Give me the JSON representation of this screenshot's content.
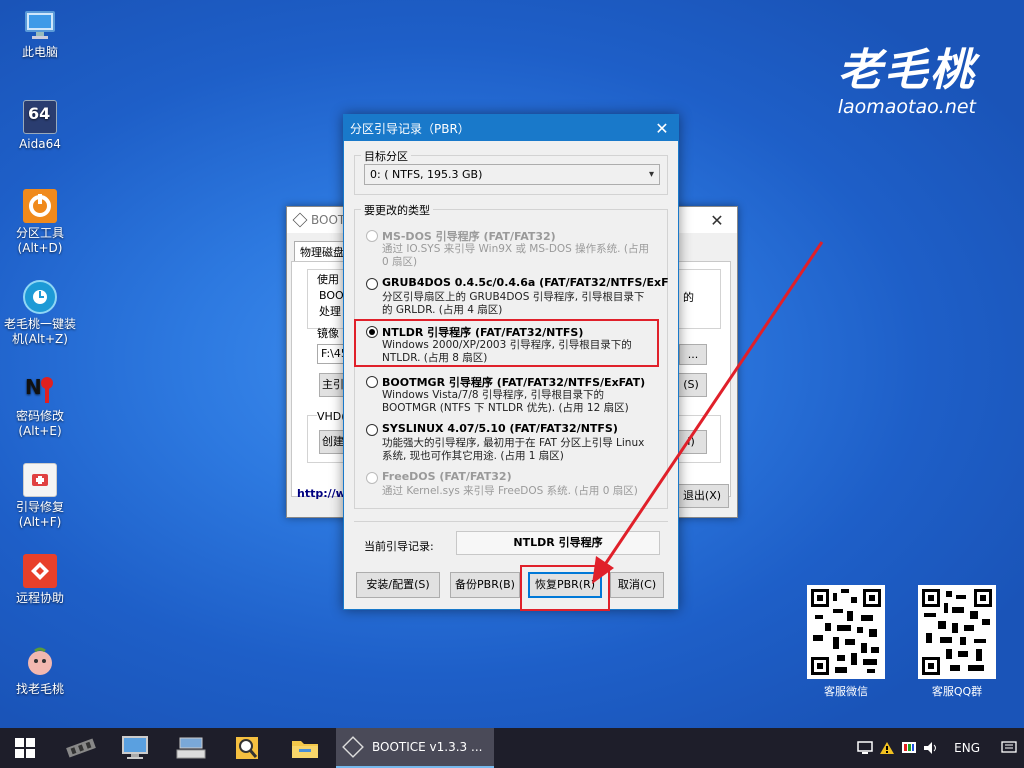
{
  "desktop": {
    "icons": [
      {
        "label": "此电脑",
        "icon": "computer-icon"
      },
      {
        "label": "Aida64",
        "icon": "aida64-icon"
      },
      {
        "label": "分区工具\n(Alt+D)",
        "icon": "partition-tool-icon"
      },
      {
        "label": "老毛桃一键装\n机(Alt+Z)",
        "icon": "one-click-install-icon"
      },
      {
        "label": "密码修改\n(Alt+E)",
        "icon": "password-change-icon"
      },
      {
        "label": "引导修复\n(Alt+F)",
        "icon": "boot-repair-icon"
      },
      {
        "label": "远程协助",
        "icon": "remote-assist-icon"
      },
      {
        "label": "找老毛桃",
        "icon": "find-laomaotao-icon"
      }
    ],
    "brand": {
      "logo_text": "老毛桃",
      "url": "laomaotao.net"
    },
    "qr_codes": [
      {
        "label": "客服微信"
      },
      {
        "label": "客服QQ群"
      }
    ]
  },
  "background_window": {
    "title": "BOOTI",
    "tab": "物理磁盘",
    "fragments": {
      "use": "使用",
      "boot1": "BOOT",
      "boot2": "处理",
      "image": "镜像",
      "path": "F:\\45",
      "master": "主引",
      "vhd": "VHD(",
      "create": "创建",
      "url": "http://w",
      "right_text": "的",
      "browse": "...",
      "s_btn": "(S)",
      "i_btn": "I)",
      "exit": "退出(X)"
    }
  },
  "dialog": {
    "title": "分区引导记录（PBR）",
    "target_group": "目标分区",
    "target_value": "0: ( NTFS, 195.3 GB)",
    "type_group": "要更改的类型",
    "options": [
      {
        "title": "MS-DOS 引导程序 (FAT/FAT32)",
        "desc": "通过 IO.SYS 来引导 Win9X 或 MS-DOS 操作系统. (占用 0 扇区)",
        "disabled": true,
        "checked": false
      },
      {
        "title": "GRUB4DOS 0.4.5c/0.4.6a (FAT/FAT32/NTFS/ExF",
        "desc": "分区引导扇区上的 GRUB4DOS 引导程序, 引导根目录下的 GRLDR. (占用 4 扇区)",
        "disabled": false,
        "checked": false
      },
      {
        "title": "NTLDR 引导程序 (FAT/FAT32/NTFS)",
        "desc": "Windows 2000/XP/2003 引导程序, 引导根目录下的 NTLDR. (占用 8 扇区)",
        "disabled": false,
        "checked": true
      },
      {
        "title": "BOOTMGR 引导程序 (FAT/FAT32/NTFS/ExFAT)",
        "desc": "Windows Vista/7/8 引导程序, 引导根目录下的 BOOTMGR (NTFS 下 NTLDR 优先). (占用 12 扇区)",
        "disabled": false,
        "checked": false
      },
      {
        "title": "SYSLINUX 4.07/5.10 (FAT/FAT32/NTFS)",
        "desc": "功能强大的引导程序, 最初用于在 FAT 分区上引导 Linux 系统, 现也可作其它用途. (占用 1 扇区)",
        "disabled": false,
        "checked": false
      },
      {
        "title": "FreeDOS (FAT/FAT32)",
        "desc": "通过 Kernel.sys 来引导 FreeDOS 系统. (占用 0 扇区)",
        "disabled": true,
        "checked": false
      }
    ],
    "current_label": "当前引导记录:",
    "current_value": "NTLDR 引导程序",
    "buttons": {
      "install": "安装/配置(S)",
      "backup": "备份PBR(B)",
      "restore": "恢复PBR(R)",
      "cancel": "取消(C)"
    }
  },
  "taskbar": {
    "app_label": "BOOTICE v1.3.3 ...",
    "lang": "ENG"
  },
  "colors": {
    "accent_blue": "#1979ca",
    "highlight_red": "#e0202a",
    "taskbar": "#1e1e2a"
  }
}
